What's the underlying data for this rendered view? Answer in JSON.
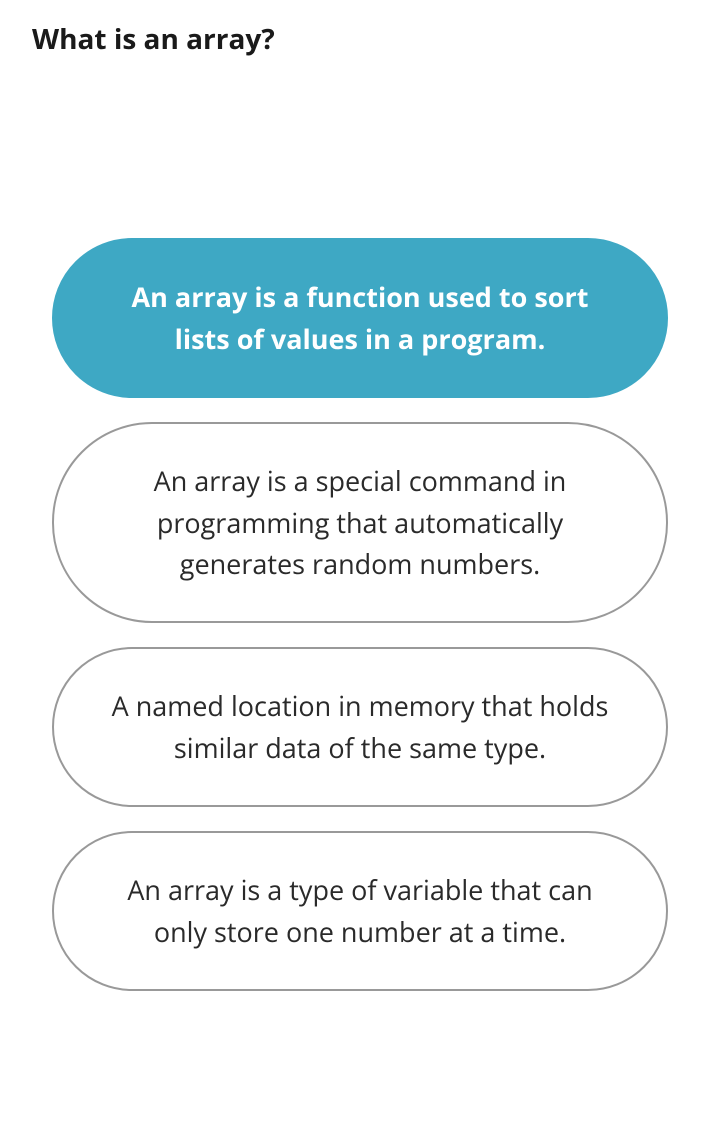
{
  "question": "What is an array?",
  "options": [
    {
      "text": "An array is a function used to sort lists of values in a program.",
      "selected": true
    },
    {
      "text": "An array is a special command in programming that automatically generates random numbers.",
      "selected": false
    },
    {
      "text": "A named location in memory that holds similar data of the same type.",
      "selected": false
    },
    {
      "text": "An array is a type of variable that can only store one number at a time.",
      "selected": false
    }
  ]
}
